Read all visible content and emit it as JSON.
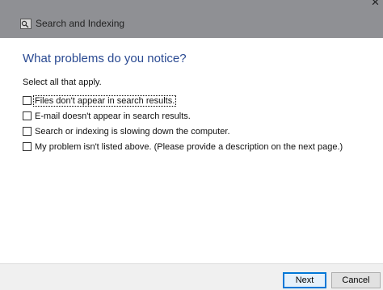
{
  "window": {
    "title": "Search and Indexing",
    "close_glyph": "×"
  },
  "content": {
    "heading": "What problems do you notice?",
    "instruction": "Select all that apply."
  },
  "options": [
    {
      "label": "Files don't appear in search results.",
      "checked": false,
      "focused": true
    },
    {
      "label": "E-mail doesn't appear in search results.",
      "checked": false,
      "focused": false
    },
    {
      "label": "Search or indexing is slowing down the computer.",
      "checked": false,
      "focused": false
    },
    {
      "label": "My problem isn't listed above. (Please provide a description on the next page.)",
      "checked": false,
      "focused": false
    }
  ],
  "footer": {
    "next_label": "Next",
    "cancel_label": "Cancel"
  },
  "colors": {
    "titlebar": "#8f9094",
    "heading": "#2a4a92",
    "footer_bg": "#f0f0f0",
    "accent": "#0078d7"
  },
  "icons": {
    "title_icon": "search-troubleshooter-icon",
    "close_icon": "close-icon"
  }
}
